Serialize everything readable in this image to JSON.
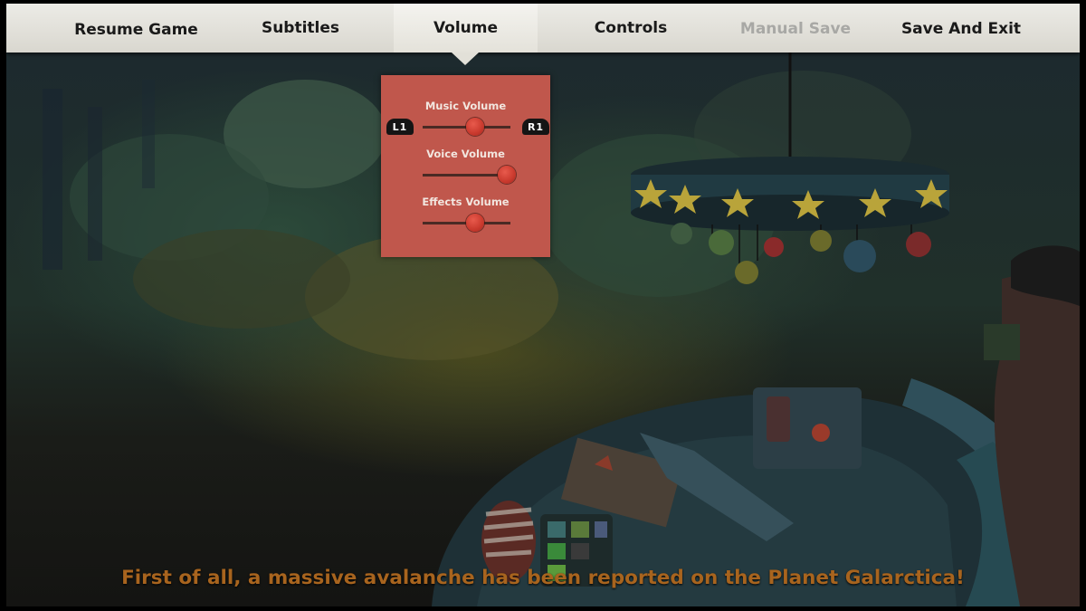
{
  "menu": {
    "tabs": [
      {
        "label": "Resume Game"
      },
      {
        "label": "Subtitles"
      },
      {
        "label": "Volume",
        "active": true
      },
      {
        "label": "Controls"
      },
      {
        "label": "Manual Save",
        "disabled": true
      },
      {
        "label": "Save And Exit"
      }
    ]
  },
  "volume_panel": {
    "left_bumper": "L1",
    "right_bumper": "R1",
    "sliders": [
      {
        "label": "Music Volume",
        "level": 0.6
      },
      {
        "label": "Voice Volume",
        "level": 1.0
      },
      {
        "label": "Effects Volume",
        "level": 0.6
      }
    ]
  },
  "subtitle": "First of all, a massive avalanche has been reported on the Planet Galarctica!",
  "colors": {
    "menu_bar": "#e2e0d8",
    "panel": "#c0574c",
    "knob": "#d9453a",
    "subtitle": "#a8641e"
  }
}
